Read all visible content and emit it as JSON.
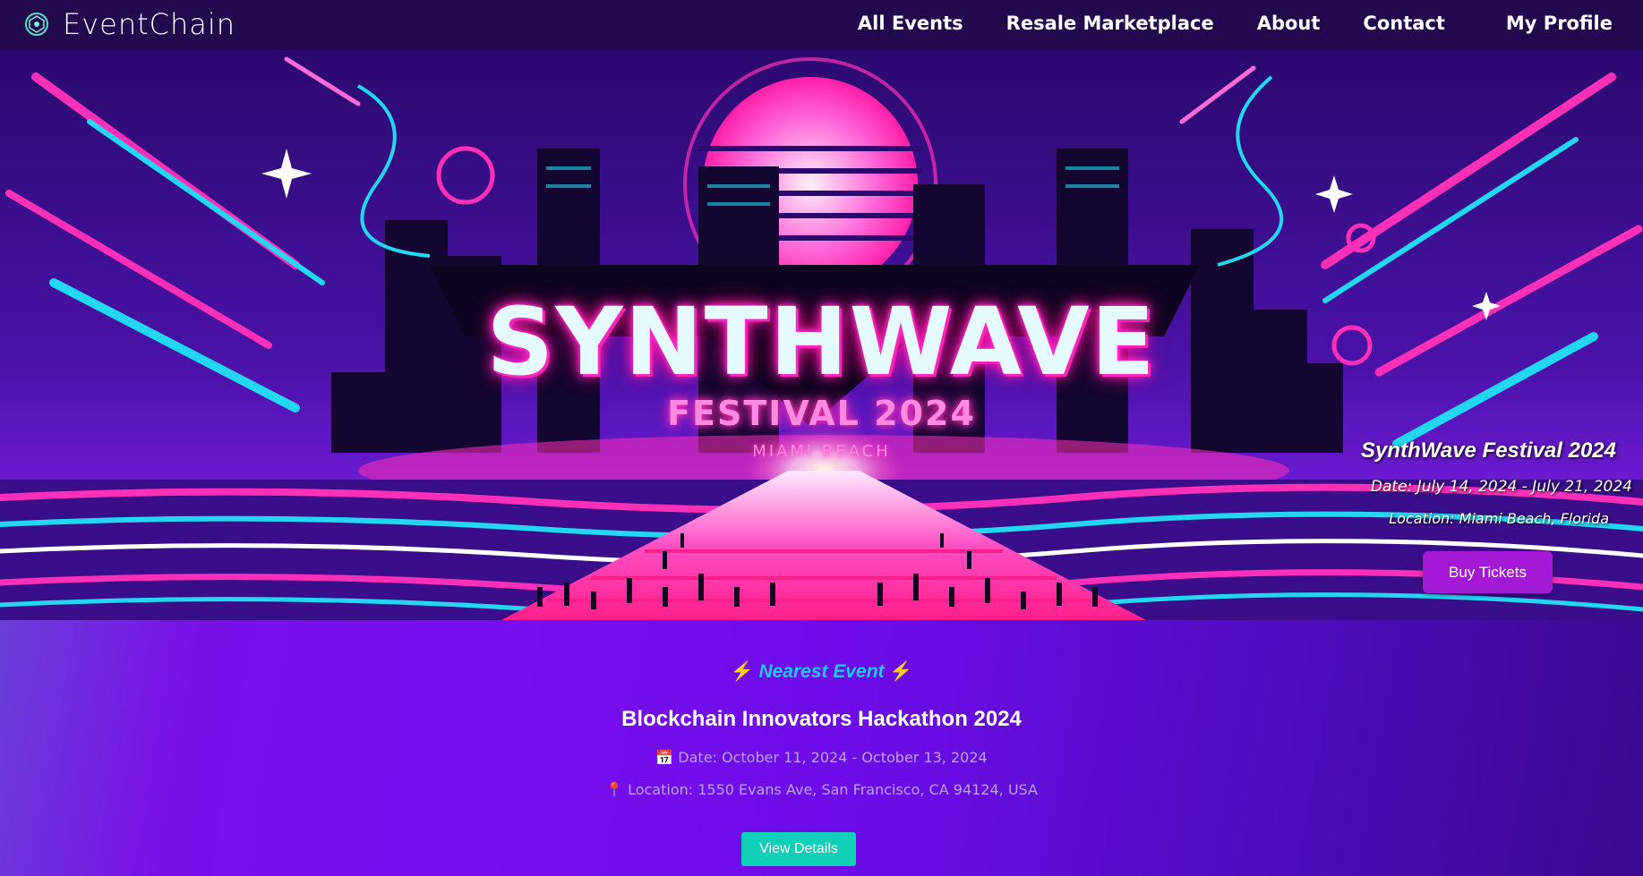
{
  "nav": {
    "brand": "EventChain",
    "links": {
      "all_events": "All Events",
      "resale": "Resale Marketplace",
      "about": "About",
      "contact": "Contact",
      "profile": "My Profile"
    }
  },
  "hero": {
    "banner_title": "SYNTHWAVE",
    "banner_subtitle": "FESTIVAL 2024",
    "banner_city": "MIAMI BEACH",
    "event_name": "SynthWave Festival 2024",
    "event_date": "Date: July 14, 2024 - July 21, 2024",
    "event_location": "Location: Miami Beach, Florida",
    "buy_label": "Buy Tickets",
    "colors": {
      "magenta": "#ff2fb8",
      "cyan": "#22d8f0",
      "purple": "#3a0d8a",
      "button": "#a319d6"
    }
  },
  "nearest": {
    "heading": "Nearest Event",
    "bolt_icon": "⚡",
    "title": "Blockchain Innovators Hackathon 2024",
    "calendar_icon": "📅",
    "date": "Date: October 11, 2024 - October 13, 2024",
    "pin_icon": "📍",
    "location": "Location: 1550 Evans Ave, San Francisco, CA 94124, USA",
    "details_label": "View Details",
    "colors": {
      "heading": "#21c8ee",
      "button": "#0fcfb7"
    }
  }
}
